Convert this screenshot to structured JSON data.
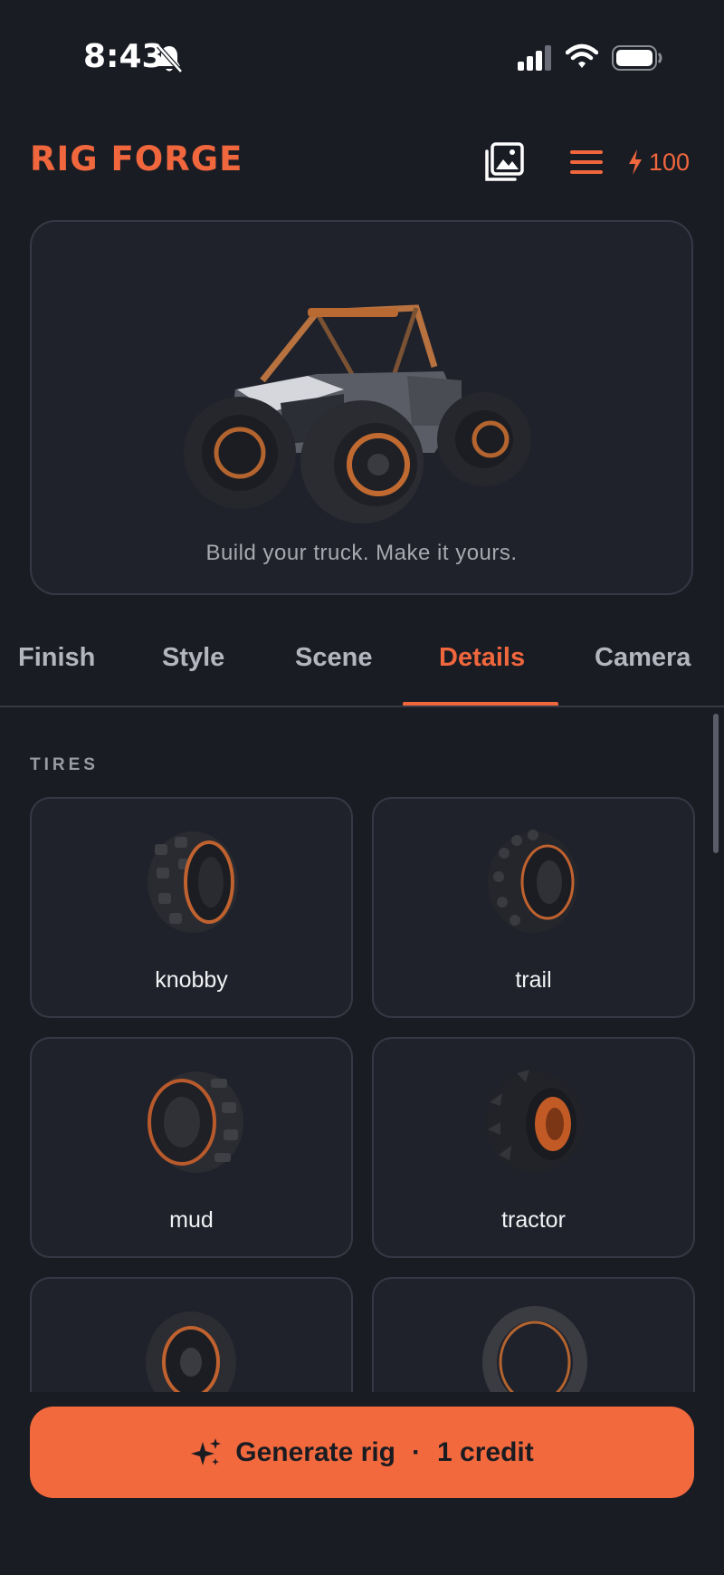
{
  "status_bar": {
    "time": "8:43"
  },
  "header": {
    "brand": "RIG FORGE",
    "credits": "100"
  },
  "hero": {
    "tagline": "Build your truck. Make it yours."
  },
  "tabs": [
    {
      "label": "Finish"
    },
    {
      "label": "Style"
    },
    {
      "label": "Scene"
    },
    {
      "label": "Details",
      "active": true
    },
    {
      "label": "Camera"
    }
  ],
  "section": {
    "label": "TIRES"
  },
  "tires": [
    {
      "label": "knobby"
    },
    {
      "label": "trail"
    },
    {
      "label": "mud"
    },
    {
      "label": "tractor"
    },
    {
      "label": ""
    },
    {
      "label": ""
    }
  ],
  "generate": {
    "label": "Generate rig",
    "separator": "·",
    "cost": "1 credit"
  },
  "colors": {
    "accent": "#f0673d",
    "background": "#1a1c24",
    "card": "#20222b",
    "border": "#363945"
  }
}
